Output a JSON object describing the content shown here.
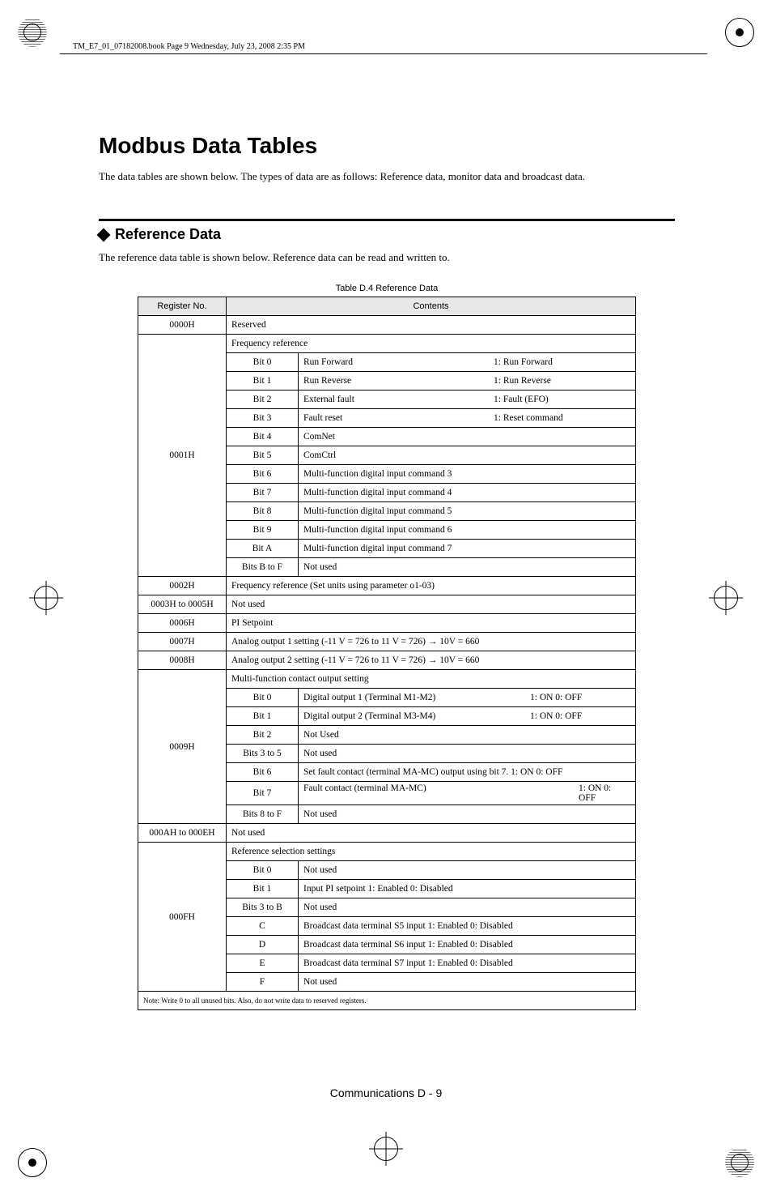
{
  "print": {
    "header_text": "TM_E7_01_07182008.book  Page 9  Wednesday, July 23, 2008  2:35 PM"
  },
  "page": {
    "title": "Modbus Data Tables",
    "intro": "The data tables are shown below. The types of data are as follows: Reference data, monitor data and broadcast data.",
    "footer": "Communications    D - 9"
  },
  "reference": {
    "heading": "Reference Data",
    "intro": "The reference data table is shown below. Reference data can be read and written to.",
    "table_caption": "Table D.4  Reference Data",
    "header_reg": "Register No.",
    "header_contents": "Contents",
    "rows": {
      "r0000H": {
        "reg": "0000H",
        "content": "Reserved"
      },
      "r0001H": {
        "reg": "0001H",
        "header": "Frequency reference",
        "bits": {
          "b0": {
            "bit": "Bit 0",
            "l": "Run Forward",
            "r": "1: Run Forward"
          },
          "b1": {
            "bit": "Bit 1",
            "l": "Run Reverse",
            "r": "1: Run Reverse"
          },
          "b2": {
            "bit": "Bit 2",
            "l": "External fault",
            "r": "1: Fault (EFO)"
          },
          "b3": {
            "bit": "Bit 3",
            "l": "Fault reset",
            "r": "1: Reset command"
          },
          "b4": {
            "bit": "Bit 4",
            "text": "ComNet"
          },
          "b5": {
            "bit": "Bit 5",
            "text": "ComCtrl"
          },
          "b6": {
            "bit": "Bit 6",
            "text": "Multi-function digital input command 3"
          },
          "b7": {
            "bit": "Bit 7",
            "text": "Multi-function digital input command 4"
          },
          "b8": {
            "bit": "Bit 8",
            "text": "Multi-function digital input command 5"
          },
          "b9": {
            "bit": "Bit 9",
            "text": "Multi-function digital input command 6"
          },
          "bA": {
            "bit": "Bit A",
            "text": "Multi-function digital input command 7"
          },
          "bBtoF": {
            "bit": "Bits B to F",
            "text": "Not used"
          }
        }
      },
      "r0002H": {
        "reg": "0002H",
        "content": "Frequency reference (Set units using parameter o1-03)"
      },
      "r0003_0005H": {
        "reg": "0003H to 0005H",
        "content": "Not used"
      },
      "r0006H": {
        "reg": "0006H",
        "content": "PI Setpoint"
      },
      "r0007H": {
        "reg": "0007H",
        "content": "Analog output 1 setting (-11 V = 726 to 11 V = 726) → 10V = 660"
      },
      "r0008H": {
        "reg": "0008H",
        "content": "Analog output 2 setting (-11 V = 726 to 11 V = 726) → 10V = 660"
      },
      "r0009H": {
        "reg": "0009H",
        "header": "Multi-function contact output setting",
        "bits": {
          "b0": {
            "bit": "Bit 0",
            "l": "Digital output 1 (Terminal M1-M2)",
            "r": "1: ON    0: OFF"
          },
          "b1": {
            "bit": "Bit 1",
            "l": "Digital output 2 (Terminal M3-M4)",
            "r": "1: ON  0: OFF"
          },
          "b2": {
            "bit": "Bit 2",
            "text": "Not Used"
          },
          "b3to5": {
            "bit": "Bits 3 to 5",
            "text": "Not used"
          },
          "b6": {
            "bit": "Bit 6",
            "text": "Set fault contact (terminal MA-MC) output using bit 7. 1: ON 0: OFF"
          },
          "b7": {
            "bit": "Bit 7",
            "l": "Fault contact (terminal MA-MC)",
            "r": "1: ON 0: OFF"
          },
          "b8toF": {
            "bit": "Bits 8 to F",
            "text": "Not used"
          }
        }
      },
      "r000A_000EH": {
        "reg": "000AH to 000EH",
        "content": "Not used"
      },
      "r000FH": {
        "reg": "000FH",
        "header": "Reference selection settings",
        "bits": {
          "b0": {
            "bit": "Bit 0",
            "text": "Not used"
          },
          "b1": {
            "bit": "Bit 1",
            "text": "Input PI setpoint 1: Enabled 0: Disabled"
          },
          "b3toB": {
            "bit": "Bits 3 to B",
            "text": "Not used"
          },
          "C": {
            "bit": "C",
            "text": "Broadcast data terminal S5 input 1: Enabled 0: Disabled"
          },
          "D": {
            "bit": "D",
            "text": "Broadcast data terminal S6 input 1: Enabled 0: Disabled"
          },
          "E": {
            "bit": "E",
            "text": "Broadcast data terminal S7 input 1: Enabled 0: Disabled"
          },
          "F": {
            "bit": "F",
            "text": "Not used"
          }
        }
      },
      "note": "Note:  Write 0 to all unused bits. Also, do not write data to reserved registers."
    }
  }
}
